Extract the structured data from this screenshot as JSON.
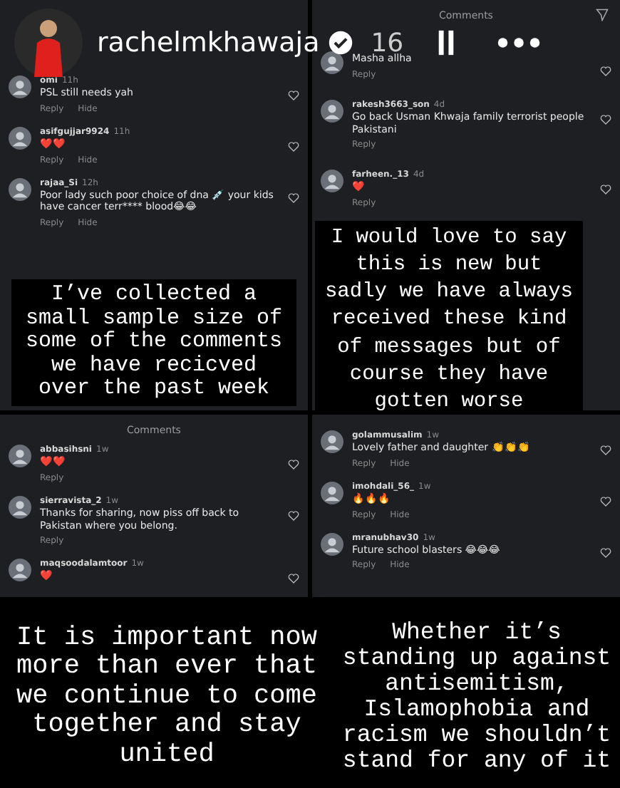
{
  "story_header": {
    "username": "rachelmkhawaja",
    "time": "16"
  },
  "panels": [
    {
      "comments": [
        {
          "user": "omi",
          "time": "11h",
          "text": "PSL still needs yah",
          "actions": [
            "Reply",
            "Hide"
          ]
        },
        {
          "user": "asifgujjar9924",
          "time": "11h",
          "text": "❤️❤️",
          "actions": [
            "Reply",
            "Hide"
          ]
        },
        {
          "user": "rajaa_Si",
          "time": "12h",
          "text": "Poor lady such poor choice of dna 💉 your kids have cancer terr**** blood😂😂",
          "actions": [
            "Reply",
            "Hide"
          ]
        }
      ],
      "caption": "I’ve collected a\nsmall sample size of\nsome of the comments\nwe have recicved\nover the past week"
    },
    {
      "title": "Comments",
      "comments": [
        {
          "text": "Masha allha",
          "actions": [
            "Reply"
          ]
        },
        {
          "user": "rakesh3663_son",
          "time": "4d",
          "text": "Go back Usman Khwaja family terrorist people Pakistani",
          "actions": [
            "Reply"
          ]
        },
        {
          "user": "farheen._13",
          "time": "4d",
          "text": "❤️",
          "actions": [
            "Reply"
          ]
        }
      ],
      "caption": "I would love to say\nthis is new but\nsadly we have always\nreceived these kind\nof messages but of\ncourse they have\ngotten worse"
    },
    {
      "title": "Comments",
      "comments": [
        {
          "user": "abbasihsni",
          "time": "1w",
          "text": "❤️❤️",
          "actions": [
            "Reply"
          ]
        },
        {
          "user": "sierravista_2",
          "time": "1w",
          "text": "Thanks for sharing, now piss off back to Pakistan where you belong.",
          "actions": [
            "Reply"
          ]
        },
        {
          "user": "maqsoodalamtoor",
          "time": "1w",
          "text": "❤️"
        }
      ]
    },
    {
      "comments": [
        {
          "user": "golammusalim",
          "time": "1w",
          "text": "Lovely father and daughter 👏👏👏",
          "actions": [
            "Reply",
            "Hide"
          ]
        },
        {
          "user": "imohdali_56_",
          "time": "1w",
          "text": "🔥🔥🔥",
          "actions": [
            "Reply",
            "Hide"
          ]
        },
        {
          "user": "mranubhav30",
          "time": "1w",
          "text": "Future school blasters 😂😂😂",
          "actions": [
            "Reply",
            "Hide"
          ]
        }
      ]
    }
  ],
  "captions": [
    "It is important now\nmore than ever that\nwe continue to come\ntogether and stay\nunited",
    "Whether it’s\nstanding up against\nantisemitism,\nIslamophobia and\nracism we shouldn’t\nstand for any of it"
  ]
}
